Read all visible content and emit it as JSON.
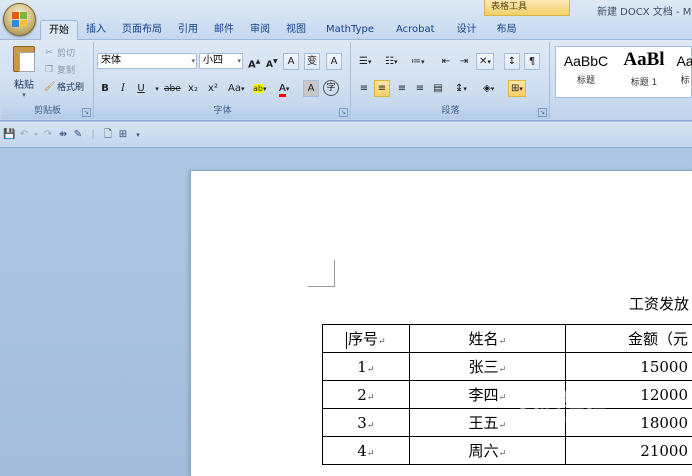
{
  "window": {
    "title": "新建 DOCX 文档 - M",
    "contextual_tab_group": "表格工具"
  },
  "tabs": [
    {
      "label": "开始",
      "active": true
    },
    {
      "label": "插入"
    },
    {
      "label": "页面布局"
    },
    {
      "label": "引用"
    },
    {
      "label": "邮件"
    },
    {
      "label": "审阅"
    },
    {
      "label": "视图"
    },
    {
      "label": "MathType"
    },
    {
      "label": "Acrobat"
    },
    {
      "label": "设计"
    },
    {
      "label": "布局"
    }
  ],
  "clipboard": {
    "group_label": "剪贴板",
    "paste_label": "粘贴",
    "cut_label": "剪切",
    "copy_label": "复制",
    "format_painter_label": "格式刷"
  },
  "font": {
    "group_label": "字体",
    "font_name": "宋体",
    "font_size": "小四",
    "grow_font": "A",
    "shrink_font": "A",
    "clear_format": "A",
    "phonetic": "变",
    "char_border": "A",
    "bold": "B",
    "italic": "I",
    "underline": "U",
    "strikethrough": "abe",
    "subscript": "x₂",
    "superscript": "x²",
    "change_case": "Aa",
    "highlight": "ab",
    "font_color": "A",
    "char_shading": "A",
    "enclose_char": "字"
  },
  "paragraph": {
    "group_label": "段落"
  },
  "styles": {
    "items": [
      {
        "sample": "AaBbC",
        "name": "标题"
      },
      {
        "sample": "AaBl",
        "name": "标题 1"
      },
      {
        "sample": "Aa",
        "name": "标"
      }
    ]
  },
  "document": {
    "heading": "工资发放",
    "table": {
      "headers": [
        "序号",
        "姓名",
        "金额（元"
      ],
      "rows": [
        [
          "1",
          "张三",
          "15000"
        ],
        [
          "2",
          "李四",
          "12000"
        ],
        [
          "3",
          "王五",
          "18000"
        ],
        [
          "4",
          "周六",
          "21000"
        ]
      ]
    }
  },
  "watermark": {
    "text": "我爱经验",
    "sub": "jingyan.baidu.com"
  },
  "colors": {
    "ribbon_bg": "#cfdef0",
    "doc_bg": "#abc3e2",
    "highlight_yellow": "#ffff00",
    "font_red": "#ff0000"
  }
}
